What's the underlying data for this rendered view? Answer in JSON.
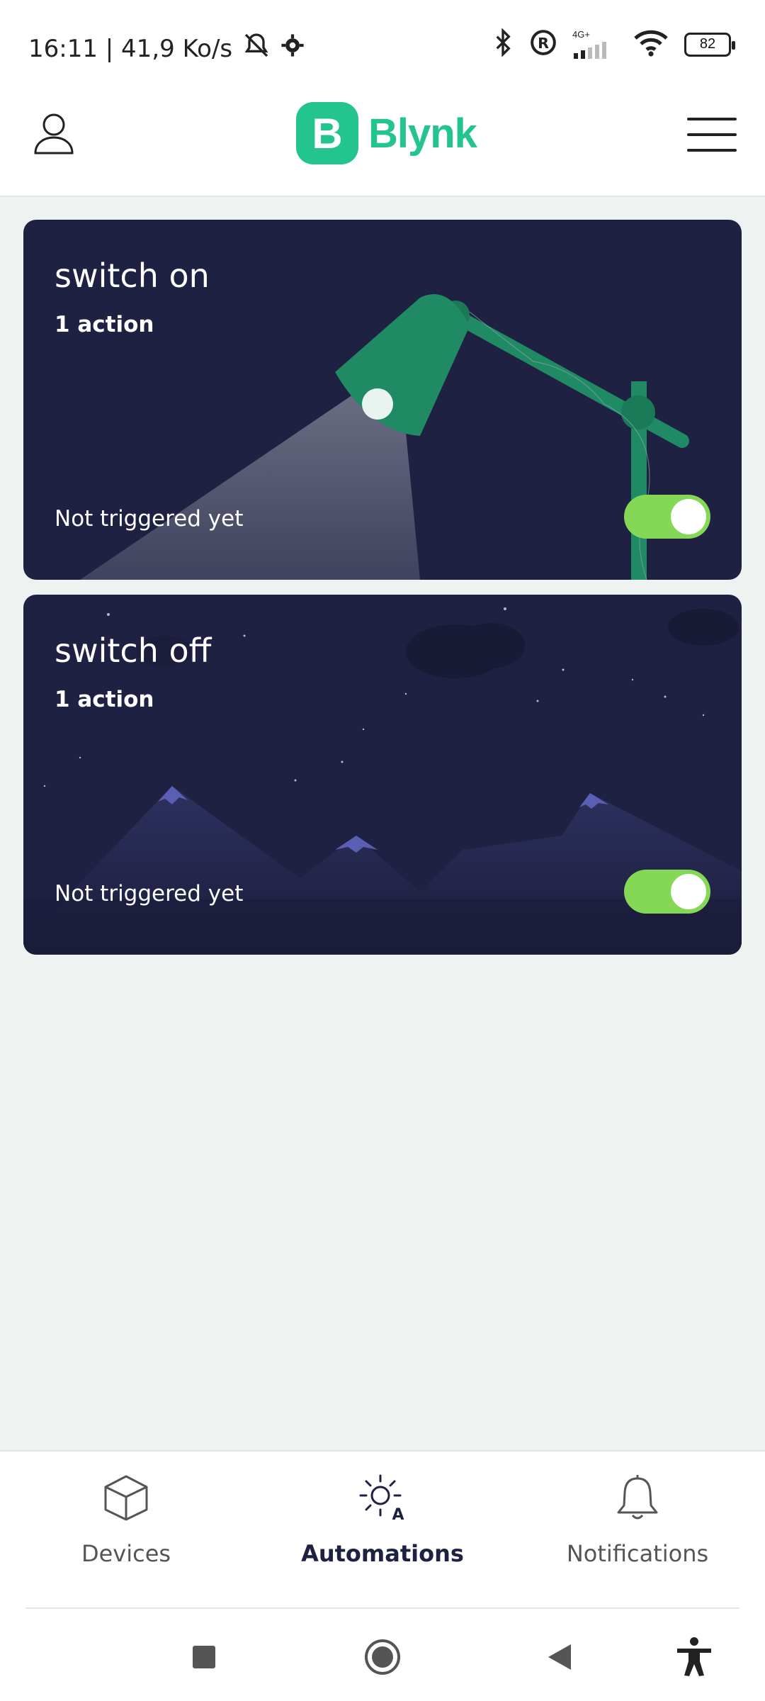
{
  "status_bar": {
    "time_speed": "16:11 | 41,9 Ko/s",
    "network_label": "4G+",
    "battery": "82"
  },
  "header": {
    "logo_letter": "B",
    "logo_text": "Blynk"
  },
  "automations": [
    {
      "title": "switch on",
      "actions": "1 action",
      "status": "Not triggered yet",
      "enabled": true
    },
    {
      "title": "switch off",
      "actions": "1 action",
      "status": "Not triggered yet",
      "enabled": true
    }
  ],
  "bottom_nav": {
    "items": [
      {
        "label": "Devices",
        "icon": "cube-icon",
        "active": false
      },
      {
        "label": "Automations",
        "icon": "automation-sun-icon",
        "active": true
      },
      {
        "label": "Notifications",
        "icon": "bell-icon",
        "active": false
      }
    ]
  },
  "colors": {
    "brand": "#23c48e",
    "card_bg": "#1e2142",
    "toggle_on": "#84d856"
  }
}
